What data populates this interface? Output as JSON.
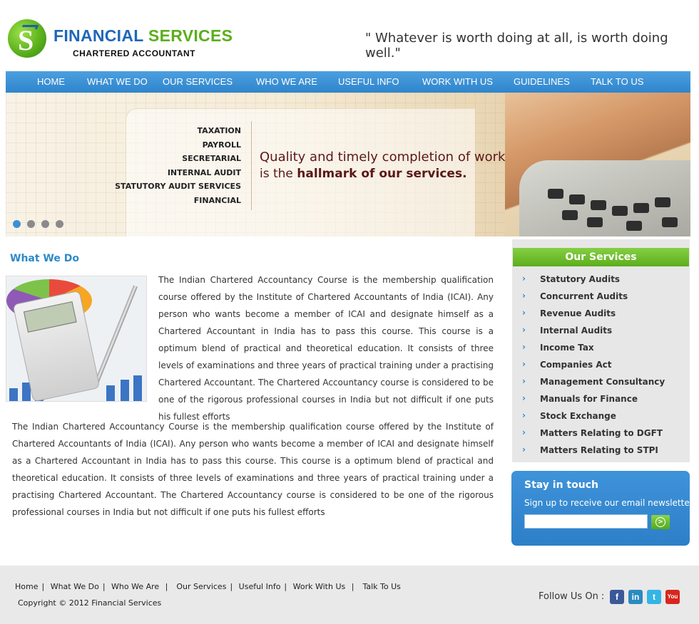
{
  "header": {
    "brand_main_a": "FINANCIAL",
    "brand_main_b": "SERVICES",
    "brand_sub": "CHARTERED ACCOUNTANT",
    "quote": "\" Whatever is worth doing at all, is worth doing well.\""
  },
  "nav": {
    "items": [
      "HOME",
      "WHAT WE DO",
      "OUR SERVICES",
      "WHO WE ARE",
      "USEFUL INFO",
      "WORK WITH US",
      "GUIDELINES",
      "TALK TO US"
    ]
  },
  "banner": {
    "services": [
      "TAXATION",
      "PAYROLL",
      "SECRETARIAL",
      "INTERNAL AUDIT",
      "STATUTORY AUDIT SERVICES",
      "FINANCIAL"
    ],
    "tagline_1": "Quality and timely completion of work",
    "tagline_2_a": "is the ",
    "tagline_2_b": "hallmark of our services.",
    "slides": 4,
    "active_slide": 1
  },
  "main": {
    "title": "What We Do",
    "para1": "The Indian Chartered Accountancy Course is the membership qualification course offered by the Institute of Chartered Accountants of India (ICAI). Any person who wants become a member of ICAI and designate himself as a Chartered Accountant in India has to pass this course. This course is a optimum blend of practical and theoretical education. It consists of three levels of examinations and three years of practical training under a practising Chartered Accountant. The Chartered Accountancy course is considered to be one of the rigorous professional courses in India but not difficult if one puts his fullest efforts",
    "para2": "The Indian Chartered Accountancy Course is the membership qualification course offered by the Institute of Chartered Accountants of India (ICAI). Any person who wants become a member of ICAI and designate himself as a Chartered Accountant in India has to pass this course. This course is a optimum blend of practical and theoretical education. It consists of three levels of examinations and three years of practical training under a practising Chartered Accountant. The Chartered Accountancy course is considered to be one of the rigorous professional courses in India but not difficult if one puts his fullest efforts"
  },
  "services": {
    "title": "Our Services",
    "items": [
      "Statutory Audits",
      "Concurrent Audits",
      "Revenue Audits",
      "Internal Audits",
      "Income Tax",
      "Companies Act",
      "Management Consultancy",
      "Manuals for Finance",
      "Stock Exchange",
      "Matters Relating to DGFT",
      "Matters Relating to STPI"
    ]
  },
  "newsletter": {
    "title": "Stay in touch",
    "subtitle": "Sign up to receive our email newsletter",
    "placeholder": "",
    "go_icon": "arrow-right-circle-icon"
  },
  "footer": {
    "links": [
      "Home",
      "What We Do",
      "Who We Are",
      "Our Services",
      "Useful Info",
      "Work With Us",
      "Talk To Us"
    ],
    "copyright": "Copyright © 2012 Financial Services",
    "follow_label": "Follow Us On :",
    "social": [
      {
        "icon": "facebook-icon",
        "glyph": "f",
        "color": "#3b5998"
      },
      {
        "icon": "linkedin-icon",
        "glyph": "in",
        "color": "#2a8ac0"
      },
      {
        "icon": "twitter-icon",
        "glyph": "t",
        "color": "#33b5e5"
      },
      {
        "icon": "youtube-icon",
        "glyph": "You",
        "color": "#d8261e"
      }
    ]
  },
  "colors": {
    "nav": "#3a92d5",
    "accent_blue": "#2c8ac8",
    "accent_green": "#5cae1c"
  }
}
